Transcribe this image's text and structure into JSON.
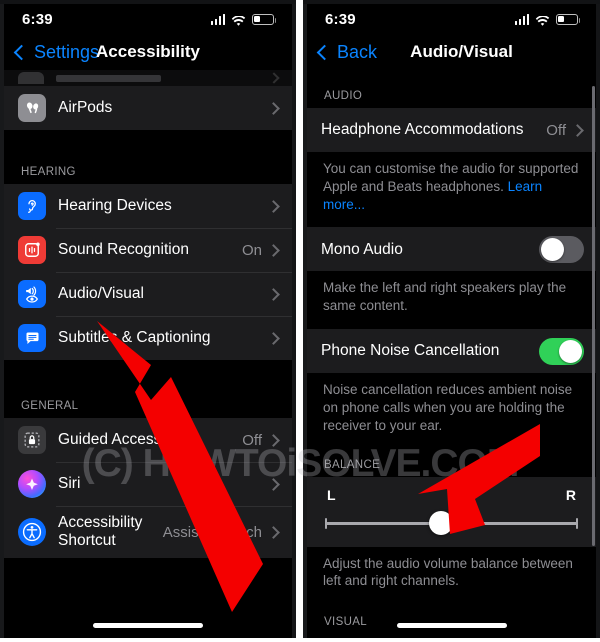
{
  "brand": {
    "watermark": "(C) HOWTOiSOLVE.COM",
    "accent_blue": "#0a84ff",
    "toggle_on_green": "#30d158",
    "arrow_red": "#f40000",
    "cell_bg": "#1c1c1e",
    "page_bg": "#000000"
  },
  "left_panel": {
    "status_bar": {
      "time": "6:39",
      "cellular_icon": "cellular-bars-icon",
      "wifi_icon": "wifi-icon",
      "battery_icon": "battery-low-icon"
    },
    "nav": {
      "back_label": "Settings",
      "back_icon": "chevron-left-icon",
      "title": "Accessibility"
    },
    "cut_off_row": {
      "label": ""
    },
    "rows_top": [
      {
        "label": "AirPods",
        "value": "",
        "icon": "airpods-icon",
        "accessory": "chevron-right-icon"
      }
    ],
    "hearing_header": "HEARING",
    "hearing_rows": [
      {
        "label": "Hearing Devices",
        "value": "",
        "icon": "ear-icon",
        "accessory": "chevron-right-icon"
      },
      {
        "label": "Sound Recognition",
        "value": "On",
        "icon": "sound-recognition-icon",
        "accessory": "chevron-right-icon"
      },
      {
        "label": "Audio/Visual",
        "value": "",
        "icon": "audio-visual-icon",
        "accessory": "chevron-right-icon"
      },
      {
        "label": "Subtitles & Captioning",
        "value": "",
        "icon": "subtitles-icon",
        "accessory": "chevron-right-icon"
      }
    ],
    "general_header": "GENERAL",
    "general_rows": [
      {
        "label": "Guided Access",
        "value": "Off",
        "icon": "guided-access-lock-icon",
        "accessory": "chevron-right-icon"
      },
      {
        "label": "Siri",
        "value": "",
        "icon": "siri-icon",
        "accessory": "chevron-right-icon"
      },
      {
        "label": "Accessibility Shortcut",
        "value": "AssistiveTouch",
        "icon": "accessibility-icon",
        "accessory": "chevron-right-icon"
      }
    ]
  },
  "right_panel": {
    "status_bar": {
      "time": "6:39",
      "cellular_icon": "cellular-bars-icon",
      "wifi_icon": "wifi-icon",
      "battery_icon": "battery-low-icon"
    },
    "nav": {
      "back_label": "Back",
      "back_icon": "chevron-left-icon",
      "title": "Audio/Visual"
    },
    "audio_header": "AUDIO",
    "headphone_row": {
      "label": "Headphone Accommodations",
      "value": "Off",
      "accessory": "chevron-right-icon"
    },
    "headphone_footnote": "You can customise the audio for supported Apple and Beats headphones. ",
    "headphone_footnote_link": "Learn more...",
    "mono_audio": {
      "label": "Mono Audio",
      "state": "off"
    },
    "mono_audio_footnote": "Make the left and right speakers play the same content.",
    "noise_cancellation": {
      "label": "Phone Noise Cancellation",
      "state": "on"
    },
    "noise_cancellation_footnote": "Noise cancellation reduces ambient noise on phone calls when you are holding the receiver to your ear.",
    "balance_header": "BALANCE",
    "balance": {
      "left_label": "L",
      "right_label": "R",
      "value_percent": 46
    },
    "balance_footnote": "Adjust the audio volume balance between left and right channels.",
    "visual_header": "VISUAL"
  }
}
